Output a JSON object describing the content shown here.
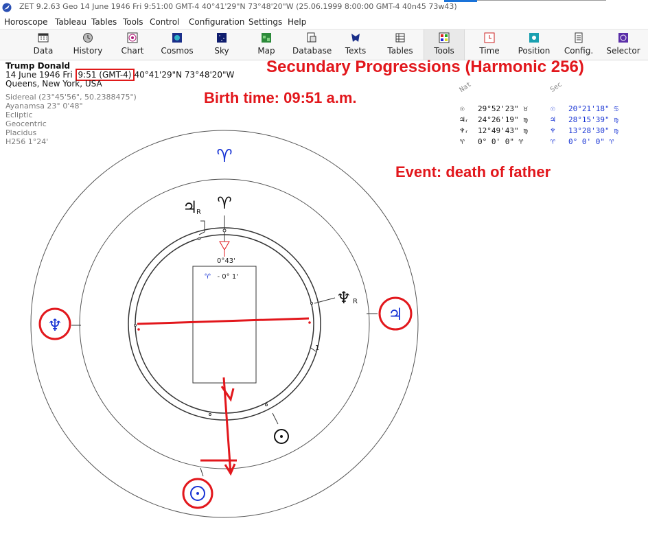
{
  "window": {
    "title": "ZET 9.2.63 Geo   14 June 1946  Fri   9:51:00 GMT-4 40°41'29\"N  73°48'20\"W  (25.06.1999   8:00:00 GMT-4 40n45 73w43)"
  },
  "menu": [
    "Horoscope",
    "Tableau",
    "Tables",
    "Tools",
    "Control",
    "Configuration",
    "Settings",
    "Help"
  ],
  "toolbar": [
    "Data",
    "History",
    "Chart",
    "Cosmos",
    "Sky",
    "Map",
    "Database",
    "Texts",
    "Tables",
    "Tools",
    "Time",
    "Position",
    "Config.",
    "Selector"
  ],
  "info": {
    "name": "Trump Donald",
    "date": "14 June 1946  Fri",
    "time": "9:51 (GMT-4)",
    "coords": "40°41'29\"N  73°48'20\"W",
    "place": "Queens, New York, USA",
    "sidereal": "Sidereal (23°45'56\", 50.2388475\")",
    "ayanamsa": "Ayanamsa 23° 0'48\"",
    "ecliptic": "Ecliptic",
    "geocentric": "Geocentric",
    "placidus": "Placidus",
    "harmonic": "H256   1°24'"
  },
  "annotations": {
    "title": "Secundary Progressions (Harmonic 256)",
    "birth": "Birth time: 09:51 a.m.",
    "event": "Event: death of father"
  },
  "legend": {
    "nat_header": "Nat",
    "sec_header": "Sec",
    "rows": [
      {
        "nat_glyph": "☉",
        "nat_value": "29°52'23\" ♉",
        "sec_glyph": "☉",
        "sec_value": "20°21'18\" ♋"
      },
      {
        "nat_glyph": "♃ᵣ",
        "nat_value": "24°26'19\" ♍",
        "sec_glyph": "♃",
        "sec_value": "28°15'39\" ♍"
      },
      {
        "nat_glyph": "♆ᵣ",
        "nat_value": "12°49'43\" ♍",
        "sec_glyph": "♆",
        "sec_value": "13°28'30\" ♍"
      },
      {
        "nat_glyph": "♈",
        "nat_value": "0° 0' 0\" ♈",
        "sec_glyph": "♈",
        "sec_value": "0° 0' 0\" ♈"
      }
    ]
  },
  "chart": {
    "aries_outer": "♈",
    "aries_inner": "♈",
    "deg_label": "0°43'",
    "box_glyph": "♈",
    "box_value": "- 0° 1'",
    "house_num": "1",
    "jupiter_retro": "R",
    "neptune_retro": "R"
  },
  "colors": {
    "annotation_red": "#e2171c",
    "secondary_blue": "#1733d4"
  }
}
